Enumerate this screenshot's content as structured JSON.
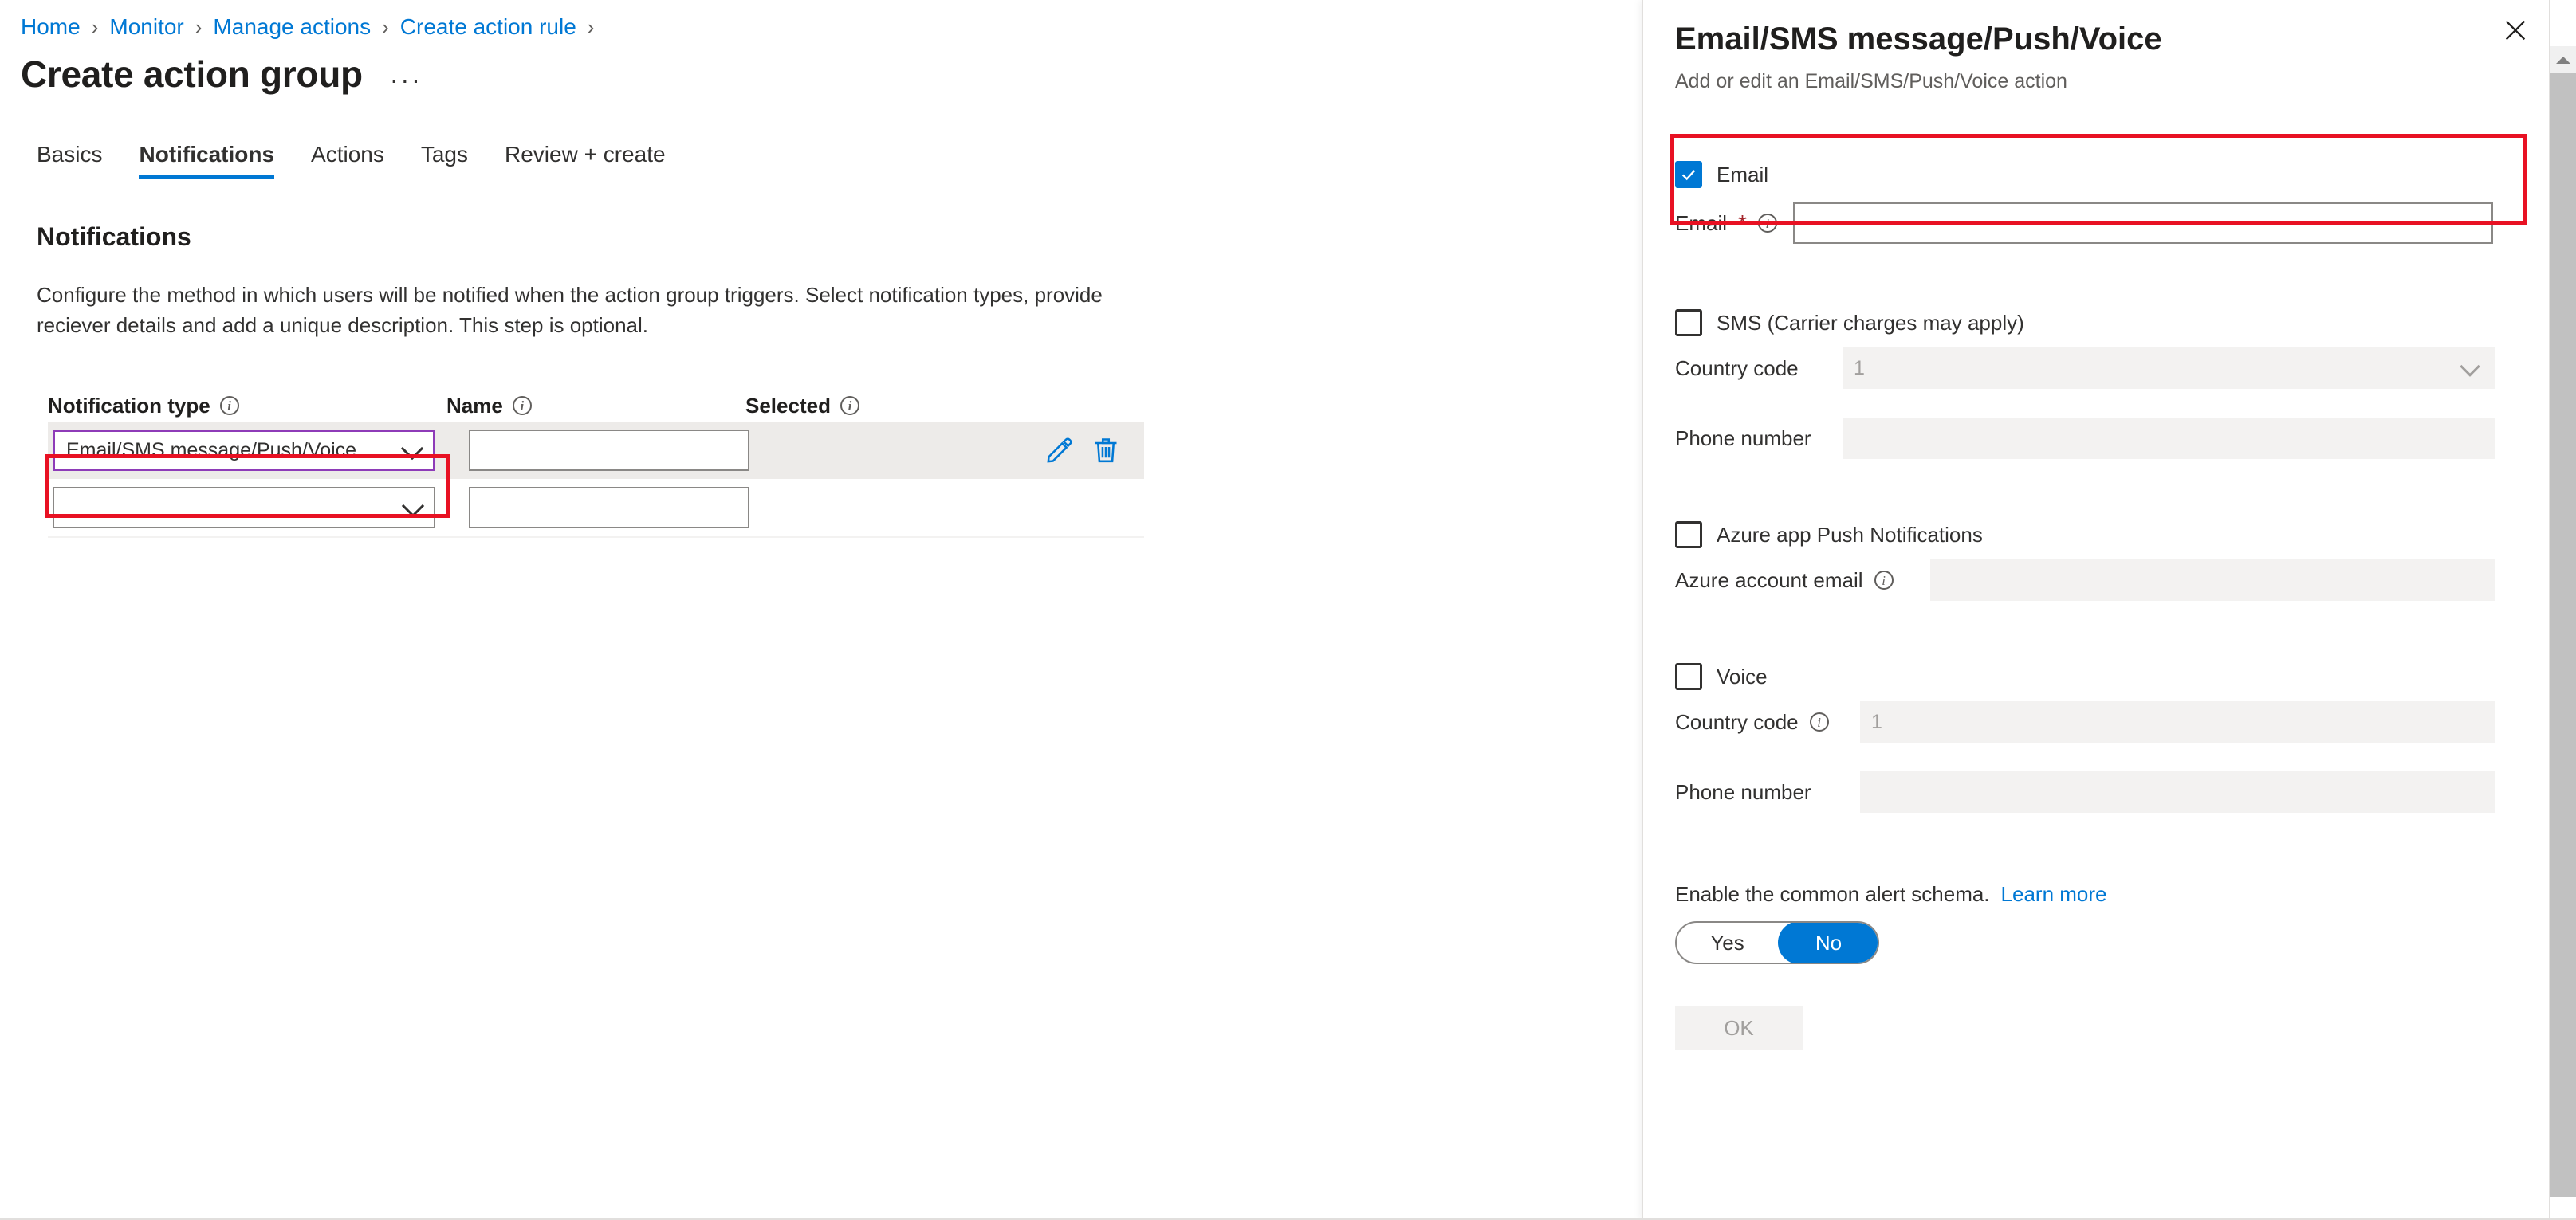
{
  "breadcrumb": {
    "items": [
      "Home",
      "Monitor",
      "Manage actions",
      "Create action rule"
    ],
    "separator": "›",
    "trailing_separator": "›"
  },
  "page": {
    "title": "Create action group",
    "more_label": "···"
  },
  "tabs": [
    {
      "label": "Basics",
      "active": false
    },
    {
      "label": "Notifications",
      "active": true
    },
    {
      "label": "Actions",
      "active": false
    },
    {
      "label": "Tags",
      "active": false
    },
    {
      "label": "Review + create",
      "active": false
    }
  ],
  "section": {
    "heading": "Notifications",
    "description": "Configure the method in which users will be notified when the action group triggers. Select notification types, provide reciever details and add a unique description. This step is optional."
  },
  "table": {
    "columns": [
      {
        "label": "Notification type",
        "info": true
      },
      {
        "label": "Name",
        "info": true
      },
      {
        "label": "Selected",
        "info": true
      }
    ],
    "rows": [
      {
        "type_value": "Email/SMS message/Push/Voice",
        "name_value": "",
        "selected_value": "",
        "focused": true,
        "highlighted": true,
        "edit_icon": "pencil-icon",
        "delete_icon": "trash-icon"
      },
      {
        "type_value": "",
        "name_value": "",
        "selected_value": "",
        "focused": false,
        "highlighted": false
      }
    ]
  },
  "blade": {
    "title": "Email/SMS message/Push/Voice",
    "subtitle": "Add or edit an Email/SMS/Push/Voice action",
    "close_label": "✕",
    "email": {
      "checkbox_label": "Email",
      "checked": true,
      "field_label": "Email",
      "required_marker": "*",
      "value": "",
      "info": true
    },
    "sms": {
      "checkbox_label": "SMS (Carrier charges may apply)",
      "checked": false,
      "country_code_label": "Country code",
      "country_code_value": "1",
      "phone_label": "Phone number",
      "phone_value": ""
    },
    "push": {
      "checkbox_label": "Azure app Push Notifications",
      "checked": false,
      "account_email_label": "Azure account email",
      "account_email_value": "",
      "info": true
    },
    "voice": {
      "checkbox_label": "Voice",
      "checked": false,
      "country_code_label": "Country code",
      "country_code_value": "1",
      "phone_label": "Phone number",
      "phone_value": "",
      "info": true
    },
    "schema": {
      "text": "Enable the common alert schema.",
      "learn_more": "Learn more",
      "options": [
        "Yes",
        "No"
      ],
      "selected": "No"
    },
    "ok_label": "OK"
  },
  "colors": {
    "accent": "#0078d4",
    "highlight_red": "#e81123",
    "focus_purple": "#8e3bb8",
    "required_red": "#a4262c",
    "row_selected_bg": "#edebe9",
    "disabled_bg": "#f3f2f1"
  }
}
